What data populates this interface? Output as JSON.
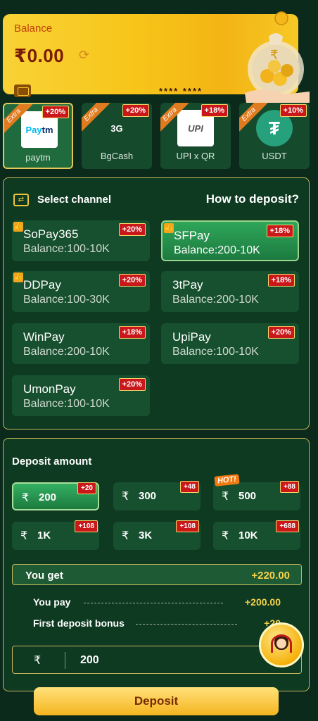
{
  "balance": {
    "label": "Balance",
    "amount": "₹0.00",
    "card_mask": "**** ****"
  },
  "methods": [
    {
      "name": "paytm",
      "logo_text": "Paytm",
      "badge": "+20%",
      "ribbon": "Extra",
      "active": true
    },
    {
      "name": "BgCash",
      "logo_text": "BG",
      "badge": "+20%",
      "ribbon": "Extra",
      "active": false
    },
    {
      "name": "UPI x QR",
      "logo_text": "UPI",
      "badge": "+18%",
      "ribbon": "Extra",
      "active": false
    },
    {
      "name": "USDT",
      "logo_text": "₮",
      "badge": "+10%",
      "ribbon": "Extra",
      "active": false
    }
  ],
  "channel": {
    "title": "Select channel",
    "help": "How to deposit?",
    "items": [
      {
        "name": "SoPay365",
        "balance": "Balance:100-10K",
        "badge": "+20%",
        "thumb": true,
        "active": false
      },
      {
        "name": "SFPay",
        "balance": "Balance:200-10K",
        "badge": "+18%",
        "thumb": true,
        "active": true
      },
      {
        "name": "DDPay",
        "balance": "Balance:100-30K",
        "badge": "+20%",
        "thumb": true,
        "active": false
      },
      {
        "name": "3tPay",
        "balance": "Balance:200-10K",
        "badge": "+18%",
        "thumb": false,
        "active": false
      },
      {
        "name": "WinPay",
        "balance": "Balance:200-10K",
        "badge": "+18%",
        "thumb": false,
        "active": false
      },
      {
        "name": "UpiPay",
        "balance": "Balance:100-10K",
        "badge": "+20%",
        "thumb": false,
        "active": false
      },
      {
        "name": "UmonPay",
        "balance": "Balance:100-10K",
        "badge": "+20%",
        "thumb": false,
        "active": false
      }
    ]
  },
  "deposit": {
    "title": "Deposit amount",
    "currency": "₹",
    "hot_label": "HOT!",
    "amounts": [
      {
        "value": "200",
        "badge": "+20",
        "active": true
      },
      {
        "value": "300",
        "badge": "+48",
        "active": false
      },
      {
        "value": "500",
        "badge": "+88",
        "active": false,
        "hot": true
      },
      {
        "value": "1K",
        "badge": "+108",
        "active": false
      },
      {
        "value": "3K",
        "badge": "+108",
        "active": false
      },
      {
        "value": "10K",
        "badge": "+688",
        "active": false
      }
    ],
    "you_get_label": "You get",
    "you_get_value": "+220.00",
    "you_pay_label": "You pay",
    "you_pay_value": "+200.00",
    "bonus_label": "First deposit bonus",
    "bonus_value": "+20",
    "input_value": "200",
    "button_label": "Deposit"
  }
}
